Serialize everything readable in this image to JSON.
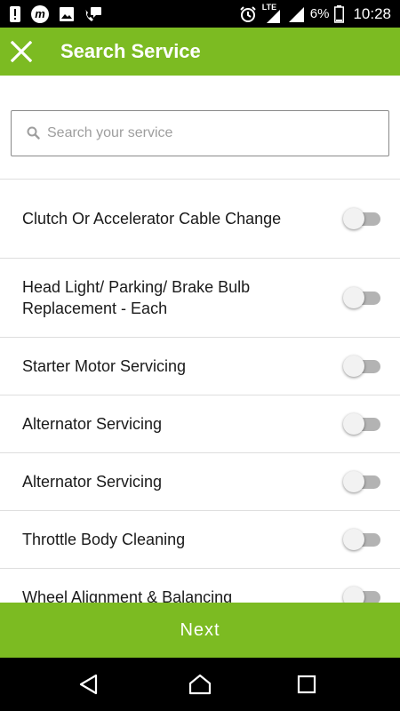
{
  "status_bar": {
    "left_icons": [
      "alert-icon",
      "m-app-icon",
      "image-icon",
      "phone-chat-icon"
    ],
    "m_letter": "m",
    "network_label": "LTE",
    "battery_percent": "6%",
    "time": "10:28"
  },
  "toolbar": {
    "close_icon": "close-icon",
    "title": "Search Service"
  },
  "search": {
    "placeholder": "Search your service",
    "value": ""
  },
  "services": [
    {
      "name": "Clutch Or Accelerator Cable Change",
      "enabled": false
    },
    {
      "name": "Head Light/ Parking/ Brake Bulb Replacement - Each",
      "enabled": false
    },
    {
      "name": "Starter Motor Servicing",
      "enabled": false
    },
    {
      "name": "Alternator Servicing",
      "enabled": false
    },
    {
      "name": "Alternator Servicing",
      "enabled": false
    },
    {
      "name": "Throttle Body Cleaning",
      "enabled": false
    },
    {
      "name": "Wheel Alignment & Balancing",
      "enabled": false
    }
  ],
  "next_label": "Next",
  "colors": {
    "accent": "#7cbb22",
    "status_bar": "#000000",
    "toggle_track_off": "#b3b3b3",
    "toggle_thumb_off": "#f2f2f2"
  },
  "nav_bar": {
    "icons": [
      "back-icon",
      "home-icon",
      "recents-icon"
    ]
  }
}
